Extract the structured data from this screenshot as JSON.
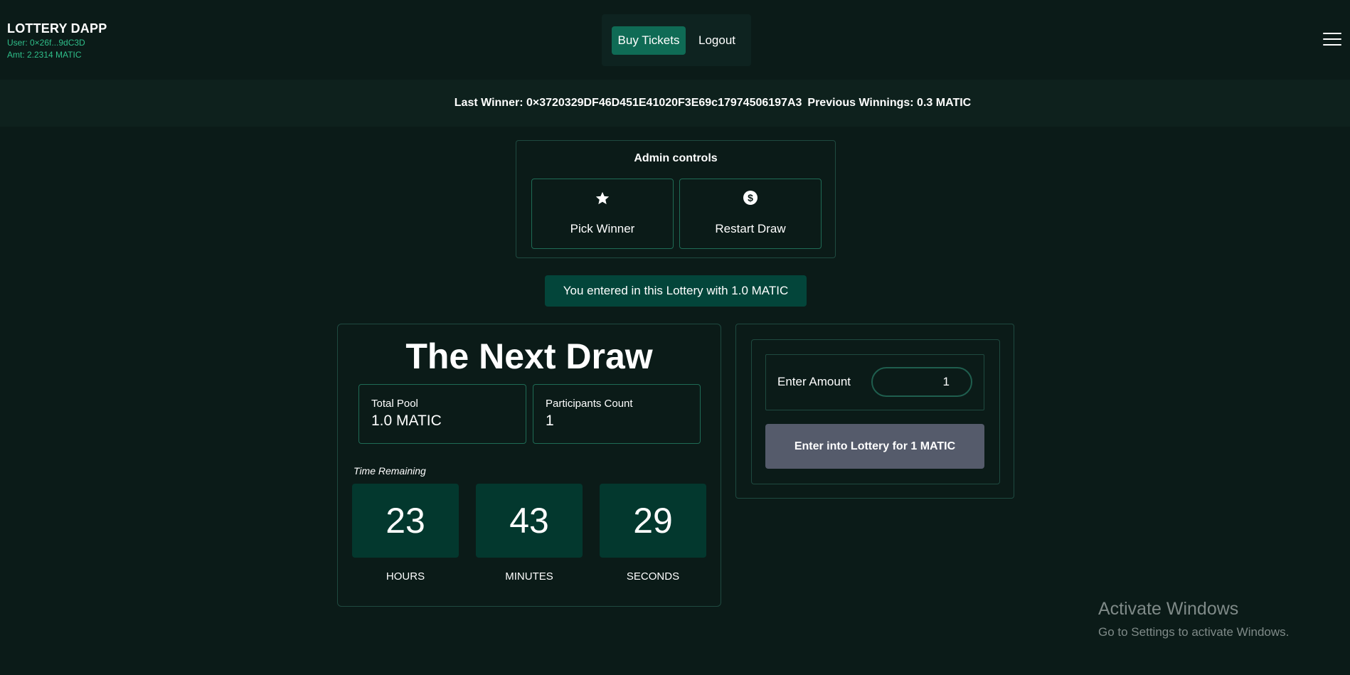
{
  "header": {
    "title": "LOTTERY DAPP",
    "user_line": "User: 0×26f...9dC3D",
    "amount_line": "Amt: 2.2314 MATIC",
    "nav": {
      "buy_tickets": "Buy Tickets",
      "logout": "Logout"
    },
    "menu_icon": "hamburger-menu-icon"
  },
  "winner_bar": {
    "last_winner": "Last Winner: 0×3720329DF46D451E41020F3E69c17974506197A3",
    "previous_winnings": "Previous Winnings: 0.3 MATIC"
  },
  "admin": {
    "title": "Admin controls",
    "pick_winner": {
      "icon": "star-icon",
      "label": "Pick Winner"
    },
    "restart_draw": {
      "icon": "dollar-circle-icon",
      "label": "Restart Draw"
    }
  },
  "notice": "You entered in this Lottery with 1.0 MATIC",
  "draw": {
    "title": "The Next Draw",
    "total_pool": {
      "label": "Total Pool",
      "value": "1.0 MATIC"
    },
    "participants": {
      "label": "Participants Count",
      "value": "1"
    },
    "time_label": "Time Remaining",
    "countdown": {
      "hours": {
        "value": "23",
        "label": "HOURS"
      },
      "minutes": {
        "value": "43",
        "label": "MINUTES"
      },
      "seconds": {
        "value": "29",
        "label": "SECONDS"
      }
    }
  },
  "entry": {
    "amount_label": "Enter Amount",
    "amount_value": "1",
    "button": "Enter into Lottery for 1 MATIC"
  },
  "watermark": {
    "title": "Activate Windows",
    "subtitle": "Go to Settings to activate Windows."
  },
  "colors": {
    "background": "#0b1b18",
    "accent": "#0f6b55",
    "brand_green": "#2fbf8a",
    "timer_box": "#03382e",
    "disabled_button": "#555b6b"
  }
}
